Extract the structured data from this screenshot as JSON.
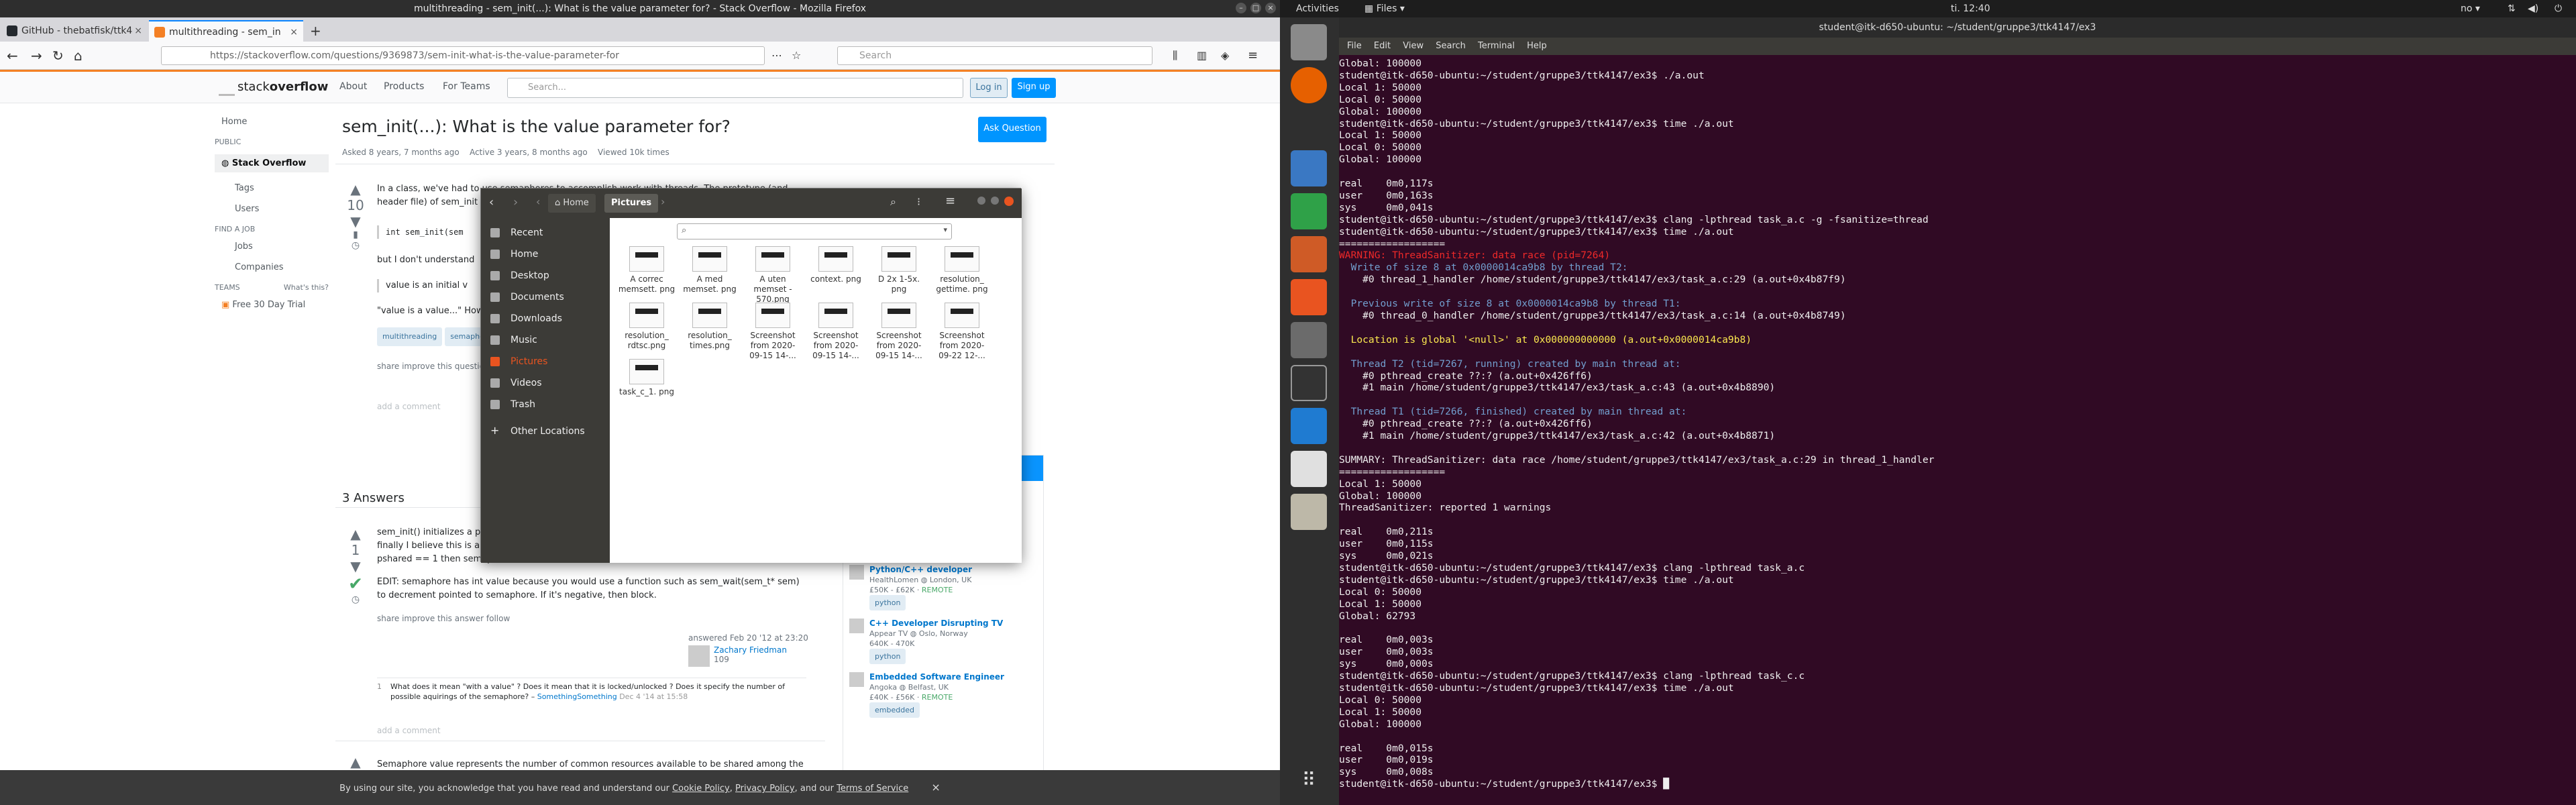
{
  "firefox": {
    "title": "multithreading - sem_init(...): What is the value parameter for? - Stack Overflow - Mozilla Firefox",
    "tabs": [
      {
        "label": "GitHub - thebatfisk/ttk4",
        "color": "#24292e"
      },
      {
        "label": "multithreading - sem_in",
        "color": "#f48024"
      }
    ],
    "url": "https://stackoverflow.com/questions/9369873/sem-init-what-is-the-value-parameter-for",
    "search_placeholder": "Search"
  },
  "so": {
    "nav": [
      "About",
      "Products",
      "For Teams"
    ],
    "search_placeholder": "Search...",
    "login": "Log in",
    "signup": "Sign up",
    "left_nav": {
      "home": "Home",
      "public": "PUBLIC",
      "stackoverflow": "Stack Overflow",
      "tags": "Tags",
      "users": "Users",
      "find_job": "FIND A JOB",
      "jobs": "Jobs",
      "companies": "Companies",
      "teams": "TEAMS",
      "whats_this": "What's this?",
      "trial": "Free 30 Day Trial"
    },
    "question_title": "sem_init(...): What is the value parameter for?",
    "ask_button": "Ask Question",
    "asked": "Asked 8 years, 7 months ago",
    "active": "Active 3 years, 8 months ago",
    "viewed": "Viewed 10k times",
    "q_body_1": "In a class, we've had to use semaphores to accomplish work with threads. The prototype (and",
    "q_body_2": "header file) of sem_init",
    "q_code": "int sem_init(sem",
    "q_body_3": "but I don't understand",
    "q_quote": "value is an initial v",
    "q_body_4": "\"value is a value...\" How",
    "vote_q": "10",
    "tags": [
      "multithreading",
      "semaphore"
    ],
    "share_q": "share  improve this question",
    "add_comment": "add a comment",
    "answers_count": "3 Answers",
    "a1_line1": "sem_init() initializes a p",
    "a1_line2": "finally I believe this is a",
    "a1_line3": "pshared == 1 then semaphore can be forked.",
    "a1_edit": "EDIT: semaphore has int value because you would use a function such as sem_wait(sem_t* sem)",
    "a1_edit2": "to decrement pointed to semaphore. If it's negative, then block.",
    "vote_a1": "1",
    "share_a": "share  improve this answer  follow",
    "answered": "answered Feb 20 '12 at 23:20",
    "answerer": "Zachary Friedman",
    "rep": "109",
    "comment_vote": "1",
    "comment": "What does it mean \"with a value\" ? Does it mean that it is locked/unlocked ? Does it specify the number of",
    "comment2": "possible aquirings of the semaphore? –",
    "comment_user": "SomethingSomething",
    "comment_date": "Dec 4 '14 at 15:58",
    "a2_line": "Semaphore value represents the number of common resources available to be shared among the",
    "jobs": [
      {
        "title": "Python/C++ developer",
        "company": "HealthLomen",
        "loc": "London, UK",
        "salary": "£50K - £62K",
        "remote": "REMOTE",
        "tag": "python"
      },
      {
        "title": "C++ Developer Disrupting TV",
        "company": "Appear TV",
        "loc": "Oslo, Norway",
        "salary": "640K - 470K",
        "remote": "",
        "tag": "python"
      },
      {
        "title": "Embedded Software Engineer",
        "company": "Angoka",
        "loc": "Belfast, UK",
        "salary": "£40K - £56K",
        "remote": "REMOTE",
        "tag": "embedded"
      }
    ],
    "cookie_text": "By using our site, you acknowledge that you have read and understand our",
    "cookie_links": [
      "Cookie Policy",
      "Privacy Policy",
      "Terms of Service"
    ]
  },
  "files": {
    "breadcrumb_home": "Home",
    "breadcrumb_current": "Pictures",
    "sidebar": [
      "Recent",
      "Home",
      "Desktop",
      "Documents",
      "Downloads",
      "Music",
      "Pictures",
      "Videos",
      "Trash",
      "Other Locations"
    ],
    "items": [
      "A correc memsett. png",
      "A med memset. png",
      "A uten memset - 570.png",
      "context. png",
      "D 2x 1-5x. png",
      "resolution_ gettime. png",
      "resolution_ rdtsc.png",
      "resolution_ times.png",
      "Screenshot from 2020-09-15 14-...",
      "Screenshot from 2020-09-15 14-...",
      "Screenshot from 2020-09-15 14-...",
      "Screenshot from 2020-09-22 12-...",
      "task_c_1. png"
    ]
  },
  "desktop": {
    "activities": "Activities",
    "app_menu": "Files",
    "clock": "ti. 12:40",
    "lang": "no"
  },
  "terminal": {
    "title": "student@itk-d650-ubuntu: ~/student/gruppe3/ttk4147/ex3",
    "menu": [
      "File",
      "Edit",
      "View",
      "Search",
      "Terminal",
      "Help"
    ],
    "lines": [
      {
        "t": "Global: 100000",
        "c": ""
      },
      {
        "t": "student@itk-d650-ubuntu:~/student/gruppe3/ttk4147/ex3$ ./a.out",
        "c": ""
      },
      {
        "t": "Local 1: 50000",
        "c": ""
      },
      {
        "t": "Local 0: 50000",
        "c": ""
      },
      {
        "t": "Global: 100000",
        "c": ""
      },
      {
        "t": "student@itk-d650-ubuntu:~/student/gruppe3/ttk4147/ex3$ time ./a.out",
        "c": ""
      },
      {
        "t": "Local 1: 50000",
        "c": ""
      },
      {
        "t": "Local 0: 50000",
        "c": ""
      },
      {
        "t": "Global: 100000",
        "c": ""
      },
      {
        "t": "",
        "c": ""
      },
      {
        "t": "real\t0m0,117s",
        "c": ""
      },
      {
        "t": "user\t0m0,163s",
        "c": ""
      },
      {
        "t": "sys \t0m0,041s",
        "c": ""
      },
      {
        "t": "student@itk-d650-ubuntu:~/student/gruppe3/ttk4147/ex3$ clang -lpthread task_a.c -g -fsanitize=thread",
        "c": ""
      },
      {
        "t": "student@itk-d650-ubuntu:~/student/gruppe3/ttk4147/ex3$ time ./a.out",
        "c": ""
      },
      {
        "t": "==================",
        "c": ""
      },
      {
        "t": "WARNING: ThreadSanitizer: data race (pid=7264)",
        "c": "t-red"
      },
      {
        "t": "  Write of size 8 at 0x0000014ca9b8 by thread T2:",
        "c": "t-blue"
      },
      {
        "t": "    #0 thread_1_handler /home/student/gruppe3/ttk4147/ex3/task_a.c:29 (a.out+0x4b87f9)",
        "c": ""
      },
      {
        "t": "",
        "c": ""
      },
      {
        "t": "  Previous write of size 8 at 0x0000014ca9b8 by thread T1:",
        "c": "t-blue"
      },
      {
        "t": "    #0 thread_0_handler /home/student/gruppe3/ttk4147/ex3/task_a.c:14 (a.out+0x4b8749)",
        "c": ""
      },
      {
        "t": "",
        "c": ""
      },
      {
        "t": "  Location is global '<null>' at 0x000000000000 (a.out+0x0000014ca9b8)",
        "c": "t-yel"
      },
      {
        "t": "",
        "c": ""
      },
      {
        "t": "  Thread T2 (tid=7267, running) created by main thread at:",
        "c": "t-blue"
      },
      {
        "t": "    #0 pthread_create ??:? (a.out+0x426ff6)",
        "c": ""
      },
      {
        "t": "    #1 main /home/student/gruppe3/ttk4147/ex3/task_a.c:43 (a.out+0x4b8890)",
        "c": ""
      },
      {
        "t": "",
        "c": ""
      },
      {
        "t": "  Thread T1 (tid=7266, finished) created by main thread at:",
        "c": "t-blue"
      },
      {
        "t": "    #0 pthread_create ??:? (a.out+0x426ff6)",
        "c": ""
      },
      {
        "t": "    #1 main /home/student/gruppe3/ttk4147/ex3/task_a.c:42 (a.out+0x4b8871)",
        "c": ""
      },
      {
        "t": "",
        "c": ""
      },
      {
        "t": "SUMMARY: ThreadSanitizer: data race /home/student/gruppe3/ttk4147/ex3/task_a.c:29 in thread_1_handler",
        "c": ""
      },
      {
        "t": "==================",
        "c": ""
      },
      {
        "t": "Local 1: 50000",
        "c": ""
      },
      {
        "t": "Global: 100000",
        "c": ""
      },
      {
        "t": "ThreadSanitizer: reported 1 warnings",
        "c": ""
      },
      {
        "t": "",
        "c": ""
      },
      {
        "t": "real\t0m0,211s",
        "c": ""
      },
      {
        "t": "user\t0m0,115s",
        "c": ""
      },
      {
        "t": "sys \t0m0,021s",
        "c": ""
      },
      {
        "t": "student@itk-d650-ubuntu:~/student/gruppe3/ttk4147/ex3$ clang -lpthread task_a.c",
        "c": ""
      },
      {
        "t": "student@itk-d650-ubuntu:~/student/gruppe3/ttk4147/ex3$ time ./a.out",
        "c": ""
      },
      {
        "t": "Local 0: 50000",
        "c": ""
      },
      {
        "t": "Local 1: 50000",
        "c": ""
      },
      {
        "t": "Global: 62793",
        "c": ""
      },
      {
        "t": "",
        "c": ""
      },
      {
        "t": "real\t0m0,003s",
        "c": ""
      },
      {
        "t": "user\t0m0,003s",
        "c": ""
      },
      {
        "t": "sys \t0m0,000s",
        "c": ""
      },
      {
        "t": "student@itk-d650-ubuntu:~/student/gruppe3/ttk4147/ex3$ clang -lpthread task_c.c",
        "c": ""
      },
      {
        "t": "student@itk-d650-ubuntu:~/student/gruppe3/ttk4147/ex3$ time ./a.out",
        "c": ""
      },
      {
        "t": "Local 0: 50000",
        "c": ""
      },
      {
        "t": "Local 1: 50000",
        "c": ""
      },
      {
        "t": "Global: 100000",
        "c": ""
      },
      {
        "t": "",
        "c": ""
      },
      {
        "t": "real\t0m0,015s",
        "c": ""
      },
      {
        "t": "user\t0m0,019s",
        "c": ""
      },
      {
        "t": "sys \t0m0,008s",
        "c": ""
      },
      {
        "t": "student@itk-d650-ubuntu:~/student/gruppe3/ttk4147/ex3$ █",
        "c": ""
      }
    ]
  }
}
